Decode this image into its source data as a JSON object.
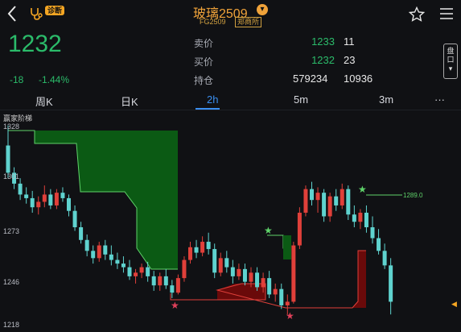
{
  "header": {
    "back_icon": "back-arrow-icon",
    "diagnose_badge": "诊断",
    "title": "玻璃2509",
    "subtitle": "FG2509",
    "exchange": "郑商所",
    "favorite_icon": "star-outline-icon",
    "menu_icon": "hamburger-menu-icon"
  },
  "quote": {
    "last": "1232",
    "change": "-18",
    "change_pct": "-1.44%",
    "ask_label": "卖价",
    "ask_price": "1233",
    "ask_vol": "11",
    "bid_label": "买价",
    "bid_price": "1232",
    "bid_vol": "23",
    "oi_label": "持仓",
    "oi": "579234",
    "oi_chg": "10936",
    "side_tab": "盘口"
  },
  "tabs": [
    {
      "label": "周K"
    },
    {
      "label": "日K"
    },
    {
      "label": "2h",
      "active": true
    },
    {
      "label": "5m"
    },
    {
      "label": "3m"
    },
    {
      "label": "···"
    }
  ],
  "chart_data": {
    "type": "candlestick",
    "indicator_label": "赢家阶梯",
    "y_ticks": [
      "1328",
      "1301",
      "1273",
      "1246",
      "1218"
    ],
    "ylim": [
      1218,
      1328
    ],
    "marker_value": "1289.0",
    "colors": {
      "up": "#e0403a",
      "down": "#5fd3cf",
      "ladder_green": "#0b5a14",
      "ladder_red": "#7a0a0a"
    },
    "candles": [
      [
        1318,
        1329,
        1300,
        1303
      ],
      [
        1303,
        1306,
        1294,
        1297
      ],
      [
        1297,
        1300,
        1288,
        1291
      ],
      [
        1291,
        1295,
        1286,
        1289
      ],
      [
        1289,
        1293,
        1281,
        1284
      ],
      [
        1284,
        1290,
        1280,
        1287
      ],
      [
        1287,
        1296,
        1284,
        1291
      ],
      [
        1291,
        1294,
        1283,
        1285
      ],
      [
        1285,
        1294,
        1283,
        1292
      ],
      [
        1292,
        1295,
        1287,
        1289
      ],
      [
        1289,
        1291,
        1279,
        1282
      ],
      [
        1282,
        1285,
        1271,
        1273
      ],
      [
        1273,
        1276,
        1264,
        1266
      ],
      [
        1266,
        1269,
        1257,
        1260
      ],
      [
        1260,
        1263,
        1253,
        1256
      ],
      [
        1256,
        1265,
        1254,
        1263
      ],
      [
        1263,
        1266,
        1255,
        1258
      ],
      [
        1258,
        1263,
        1252,
        1255
      ],
      [
        1255,
        1259,
        1250,
        1253
      ],
      [
        1253,
        1257,
        1248,
        1251
      ],
      [
        1251,
        1255,
        1244,
        1246
      ],
      [
        1246,
        1250,
        1242,
        1248
      ],
      [
        1248,
        1253,
        1245,
        1251
      ],
      [
        1251,
        1254,
        1243,
        1246
      ],
      [
        1246,
        1249,
        1238,
        1241
      ],
      [
        1241,
        1248,
        1238,
        1246
      ],
      [
        1246,
        1250,
        1239,
        1241
      ],
      [
        1241,
        1244,
        1234,
        1237
      ],
      [
        1237,
        1247,
        1236,
        1245
      ],
      [
        1245,
        1257,
        1243,
        1255
      ],
      [
        1255,
        1265,
        1253,
        1262
      ],
      [
        1262,
        1266,
        1256,
        1259
      ],
      [
        1259,
        1268,
        1257,
        1265
      ],
      [
        1265,
        1270,
        1258,
        1261
      ],
      [
        1261,
        1264,
        1245,
        1248
      ],
      [
        1248,
        1259,
        1246,
        1256
      ],
      [
        1256,
        1260,
        1248,
        1251
      ],
      [
        1251,
        1255,
        1242,
        1246
      ],
      [
        1246,
        1253,
        1244,
        1250
      ],
      [
        1250,
        1253,
        1241,
        1243
      ],
      [
        1243,
        1251,
        1240,
        1248
      ],
      [
        1248,
        1251,
        1238,
        1240
      ],
      [
        1240,
        1248,
        1237,
        1245
      ],
      [
        1245,
        1249,
        1234,
        1236
      ],
      [
        1236,
        1242,
        1232,
        1239
      ],
      [
        1239,
        1242,
        1228,
        1230
      ],
      [
        1230,
        1236,
        1225,
        1232
      ],
      [
        1232,
        1265,
        1231,
        1263
      ],
      [
        1263,
        1284,
        1261,
        1281
      ],
      [
        1281,
        1296,
        1279,
        1294
      ],
      [
        1294,
        1298,
        1285,
        1288
      ],
      [
        1288,
        1295,
        1281,
        1292
      ],
      [
        1292,
        1294,
        1276,
        1279
      ],
      [
        1279,
        1292,
        1276,
        1290
      ],
      [
        1290,
        1294,
        1282,
        1285
      ],
      [
        1285,
        1297,
        1283,
        1294
      ],
      [
        1294,
        1296,
        1277,
        1280
      ],
      [
        1280,
        1285,
        1273,
        1276
      ],
      [
        1276,
        1283,
        1272,
        1281
      ],
      [
        1281,
        1285,
        1270,
        1273
      ],
      [
        1273,
        1279,
        1264,
        1267
      ],
      [
        1267,
        1272,
        1258,
        1260
      ],
      [
        1260,
        1264,
        1250,
        1252
      ],
      [
        1252,
        1256,
        1225,
        1232
      ]
    ]
  }
}
